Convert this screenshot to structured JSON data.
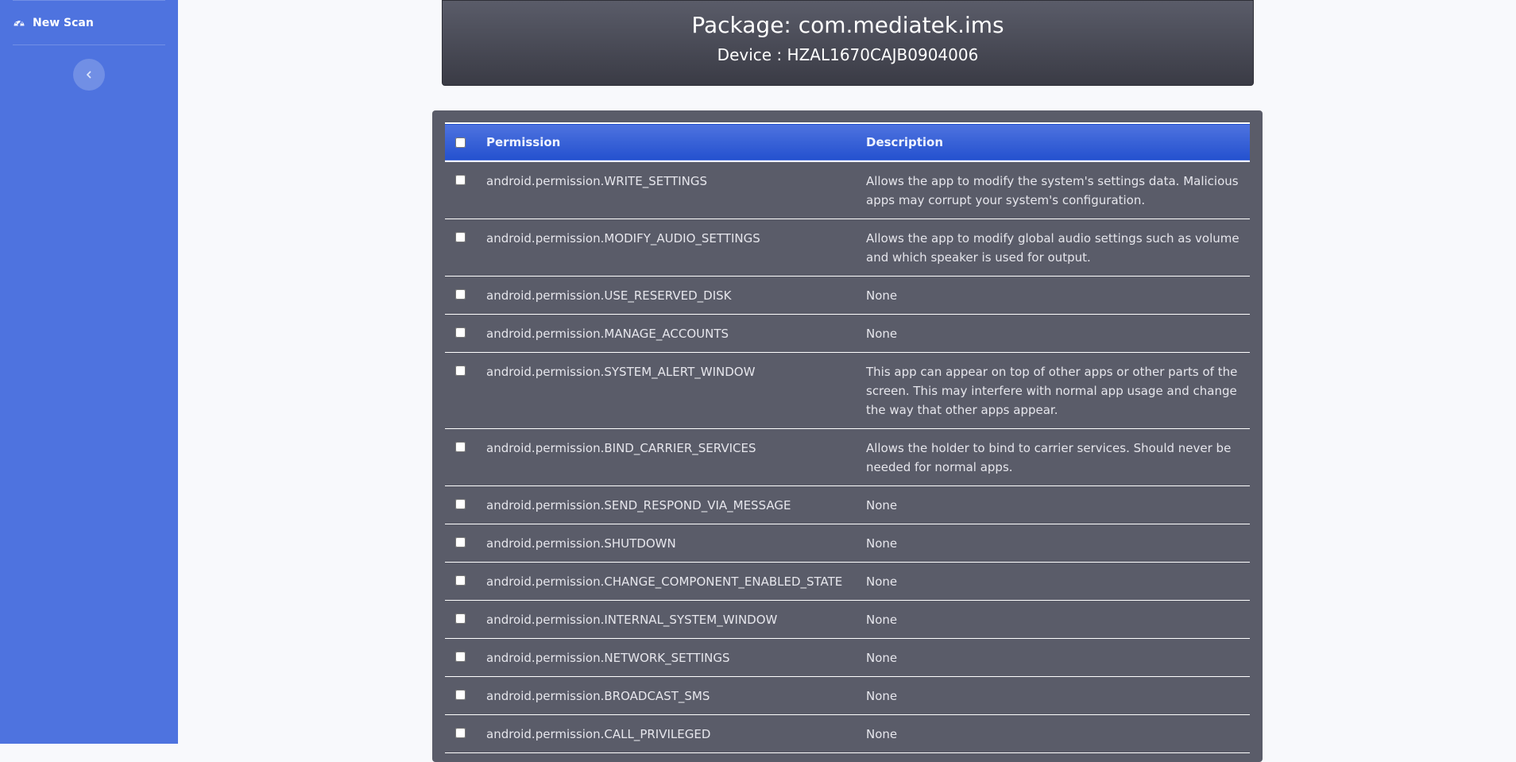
{
  "sidebar": {
    "nav_items": [
      {
        "label": "New Scan",
        "icon": "tachometer-icon"
      }
    ],
    "toggle_icon": "chevron-left-icon"
  },
  "header": {
    "package_title": "Package: com.mediatek.ims",
    "device_line": "Device : HZAL1670CAJB0904006"
  },
  "table": {
    "columns": [
      "Permission",
      "Description"
    ],
    "rows": [
      {
        "permission": "android.permission.WRITE_SETTINGS",
        "description": "Allows the app to modify the system's settings data. Malicious apps may corrupt your system's configuration."
      },
      {
        "permission": "android.permission.MODIFY_AUDIO_SETTINGS",
        "description": "Allows the app to modify global audio settings such as volume and which speaker is used for output."
      },
      {
        "permission": "android.permission.USE_RESERVED_DISK",
        "description": "None"
      },
      {
        "permission": "android.permission.MANAGE_ACCOUNTS",
        "description": "None"
      },
      {
        "permission": "android.permission.SYSTEM_ALERT_WINDOW",
        "description": "This app can appear on top of other apps or other parts of the screen. This may interfere with normal app usage and change the way that other apps appear."
      },
      {
        "permission": "android.permission.BIND_CARRIER_SERVICES",
        "description": "Allows the holder to bind to carrier services. Should never be needed for normal apps."
      },
      {
        "permission": "android.permission.SEND_RESPOND_VIA_MESSAGE",
        "description": "None"
      },
      {
        "permission": "android.permission.SHUTDOWN",
        "description": "None"
      },
      {
        "permission": "android.permission.CHANGE_COMPONENT_ENABLED_STATE",
        "description": "None"
      },
      {
        "permission": "android.permission.INTERNAL_SYSTEM_WINDOW",
        "description": "None"
      },
      {
        "permission": "android.permission.NETWORK_SETTINGS",
        "description": "None"
      },
      {
        "permission": "android.permission.BROADCAST_SMS",
        "description": "None"
      },
      {
        "permission": "android.permission.CALL_PRIVILEGED",
        "description": "None"
      }
    ]
  },
  "colors": {
    "sidebar": "#4e73df",
    "page_background": "#f8f9fc",
    "card_dark": "#5a5c69",
    "header_gradient_top": "#4e73df",
    "header_gradient_bottom": "#2451cf"
  }
}
